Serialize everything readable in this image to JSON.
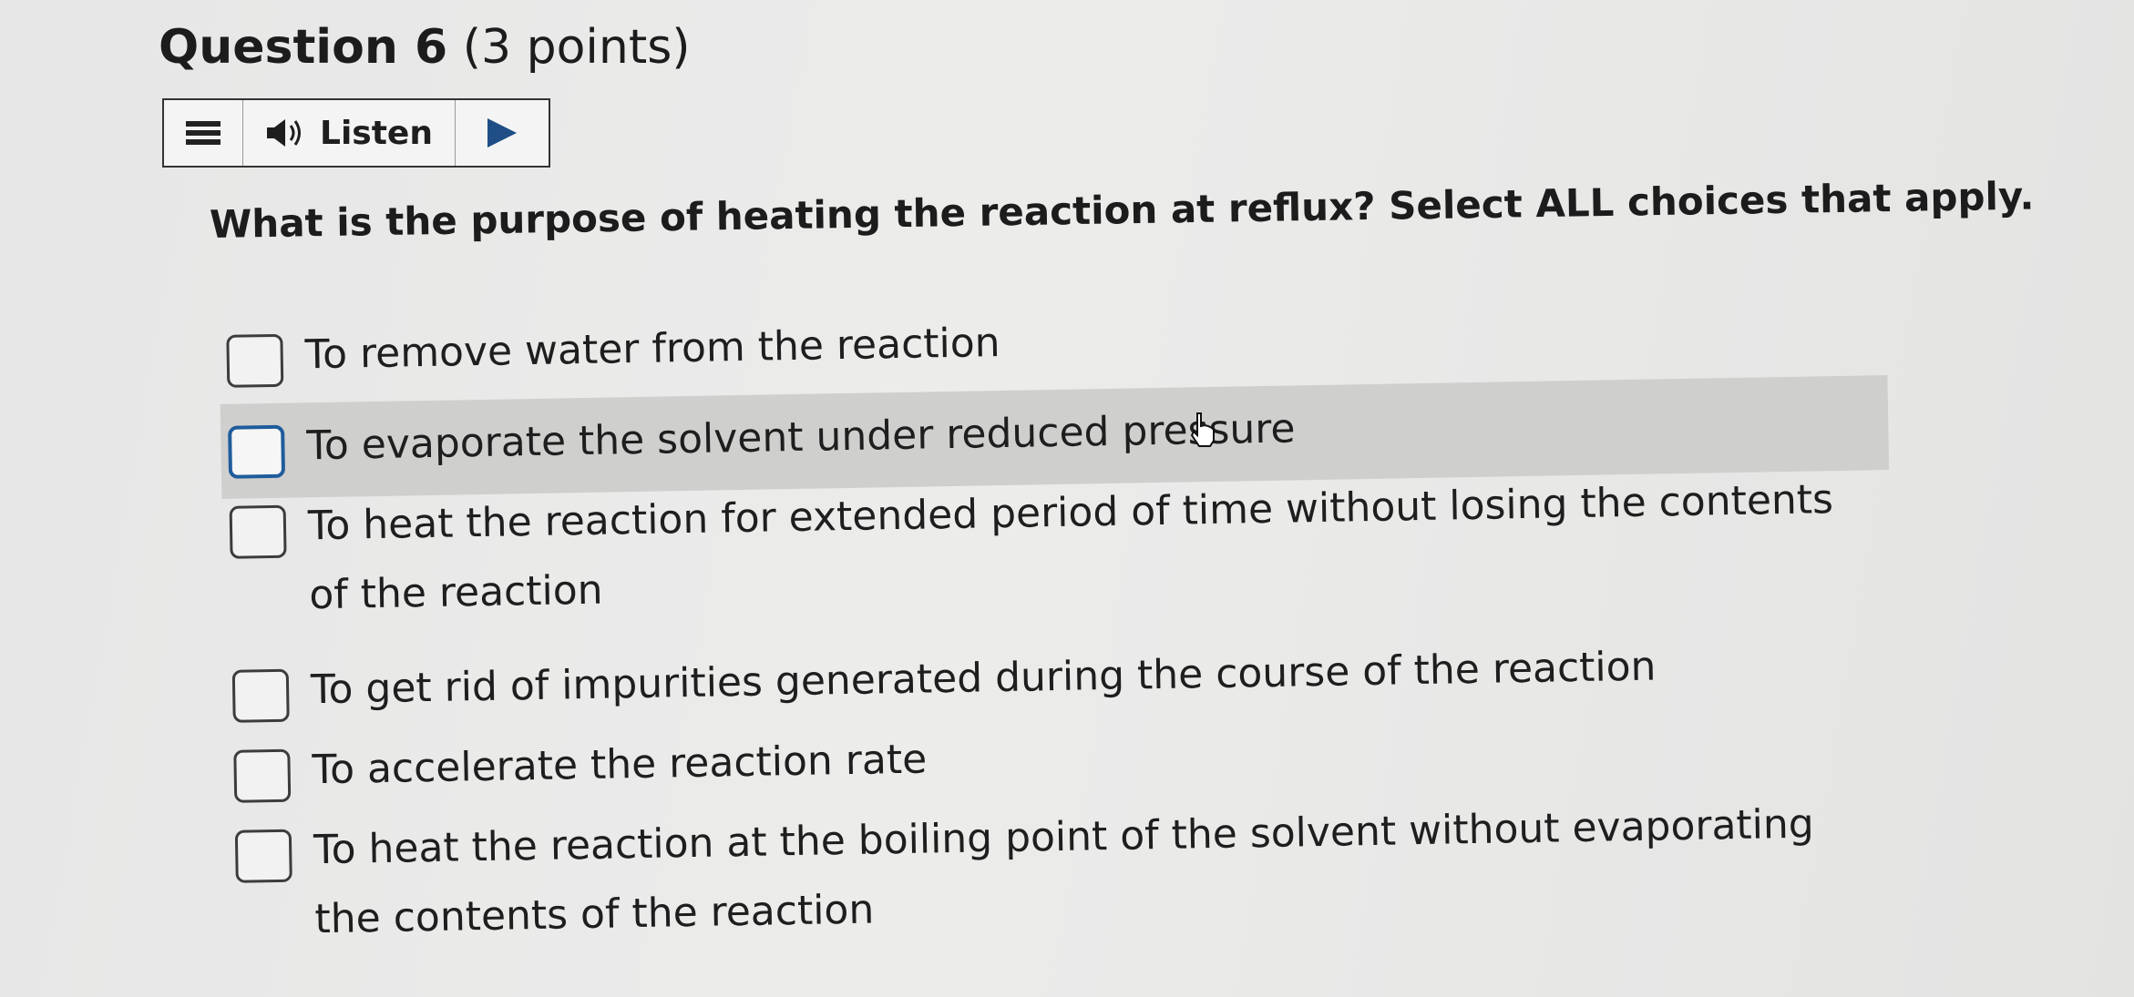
{
  "question": {
    "number_label": "Question 6",
    "points_label": "(3 points)"
  },
  "listen_bar": {
    "listen_label": "Listen"
  },
  "prompt": "What is the purpose of heating the reaction at reflux? Select ALL choices that apply.",
  "choices": [
    {
      "label": "To remove water from the reaction",
      "checked": false
    },
    {
      "label": "To evaporate the solvent under reduced pressure",
      "checked": false,
      "hovered": true
    },
    {
      "label": "To heat the reaction for extended period of time without losing the contents of the reaction",
      "checked": false
    },
    {
      "label": "To get rid of impurities generated during the course of the reaction",
      "checked": false
    },
    {
      "label": "To accelerate the reaction rate",
      "checked": false
    },
    {
      "label": "To heat the reaction at the boiling point of the solvent without evaporating the contents of the reaction",
      "checked": false
    }
  ],
  "colors": {
    "hover_row": "#cfcfce",
    "focus_checkbox_border": "#1f5c9c",
    "play_icon": "#1f4e86"
  }
}
